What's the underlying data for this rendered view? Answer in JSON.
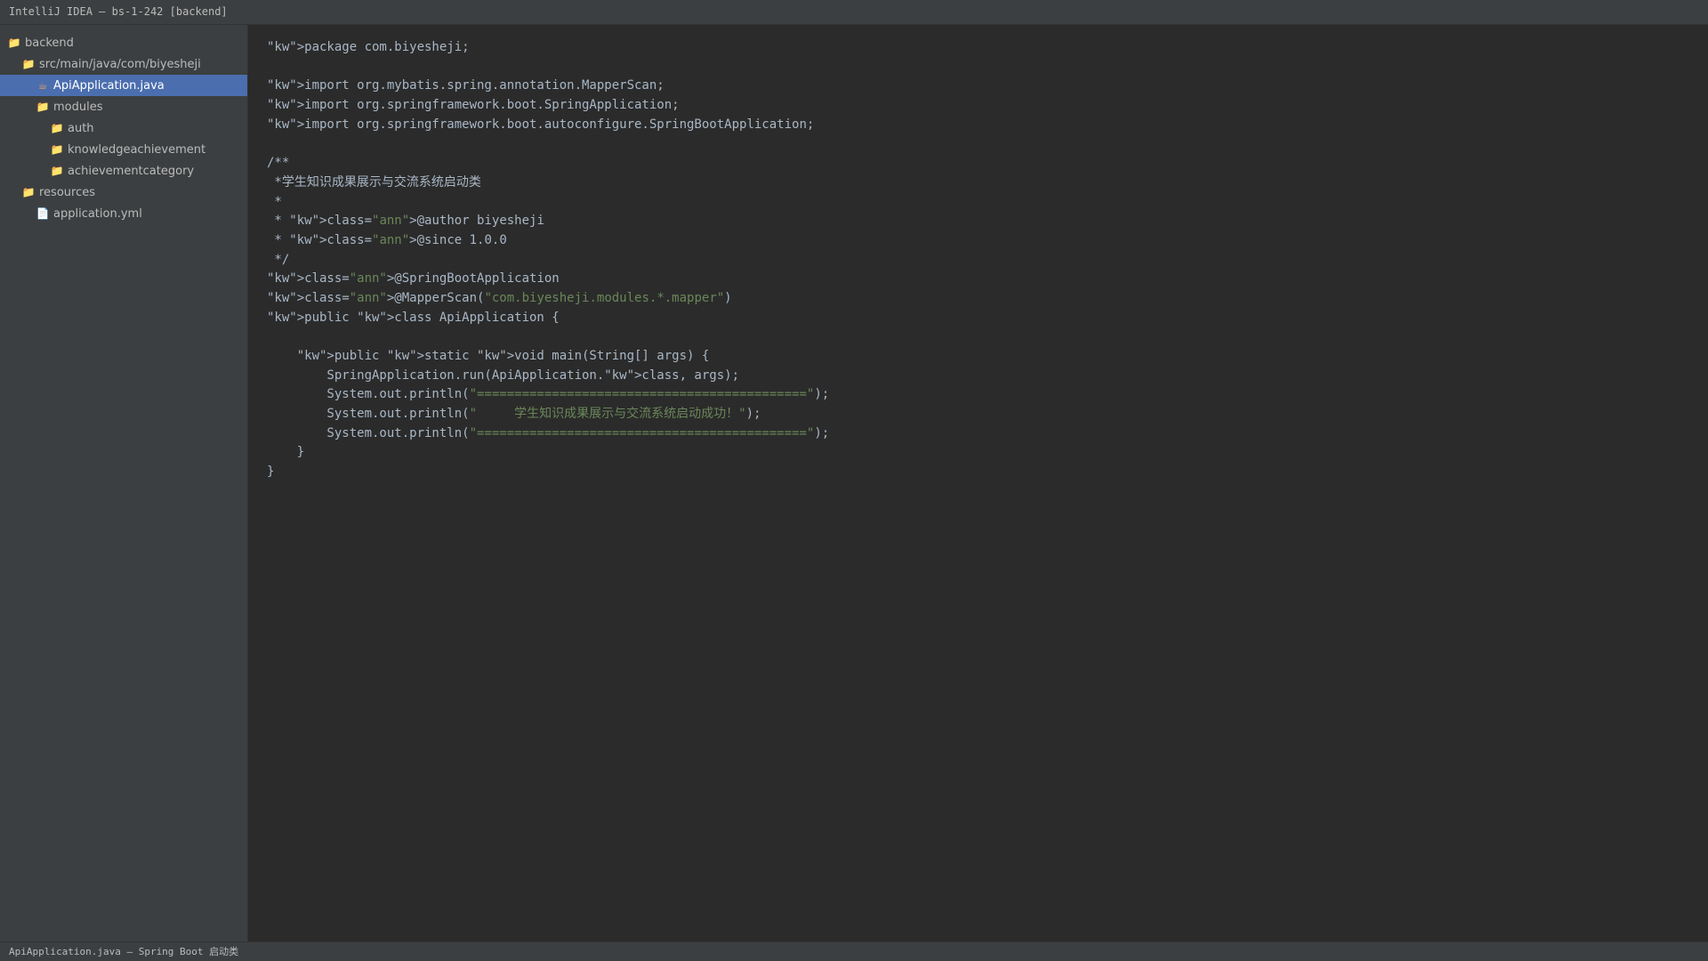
{
  "window": {
    "title": "IntelliJ IDEA — bs-1-242 [backend]"
  },
  "project_tree": {
    "items": [
      {
        "label": "backend",
        "icon": "folder-icon",
        "depth": 0,
        "selected": false
      },
      {
        "label": "src/main/java/com/biyesheji",
        "icon": "folder-icon",
        "depth": 1,
        "selected": false
      },
      {
        "label": "ApiApplication.java",
        "icon": "java-file-icon",
        "depth": 2,
        "selected": true
      },
      {
        "label": "modules",
        "icon": "folder-icon",
        "depth": 2,
        "selected": false
      },
      {
        "label": "auth",
        "icon": "folder-icon",
        "depth": 3,
        "selected": false
      },
      {
        "label": "knowledgeachievement",
        "icon": "folder-icon",
        "depth": 3,
        "selected": false
      },
      {
        "label": "achievementcategory",
        "icon": "folder-icon",
        "depth": 3,
        "selected": false
      },
      {
        "label": "resources",
        "icon": "folder-icon",
        "depth": 1,
        "selected": false
      },
      {
        "label": "application.yml",
        "icon": "file-icon",
        "depth": 2,
        "selected": false
      }
    ]
  },
  "editor": {
    "lines": [
      [
        {
          "t": "\"kw\">package com.biyesheji;"
        }
      ],
      [],
      [
        {
          "t": "\"kw\">import org.mybatis.spring.annotation.MapperScan;"
        }
      ],
      [
        {
          "t": "\"kw\">import org.springframework.boot.SpringApplication;"
        }
      ],
      [
        {
          "t": "\"kw\">import org.springframework.boot.autoconfigure.SpringBootApplication;"
        }
      ],
      [],
      [
        {
          "t": "/**"
        }
      ],
      [
        {
          "t": " *学生知识成果展示与交流系统启动类"
        }
      ],
      [
        {
          "t": " *"
        }
      ],
      [
        {
          "t": " * \"kw\">class="
        },
        {
          "t": "\"ann\"",
          "c": "str"
        },
        {
          "t": ">@author biyesheji"
        }
      ],
      [
        {
          "t": " * \"kw\">class="
        },
        {
          "t": "\"ann\"",
          "c": "str"
        },
        {
          "t": ">@since 1.0.0"
        }
      ],
      [
        {
          "t": " */"
        }
      ],
      [
        {
          "t": "\"kw\">class="
        },
        {
          "t": "\"ann\"",
          "c": "str"
        },
        {
          "t": ">@SpringBootApplication"
        }
      ],
      [
        {
          "t": "\"kw\">class="
        },
        {
          "t": "\"ann\"",
          "c": "str"
        },
        {
          "t": ">@MapperScan("
        },
        {
          "t": "\"com.biyesheji.modules.*.mapper\"",
          "c": "str"
        },
        {
          "t": ")"
        }
      ],
      [
        {
          "t": "\"kw\">public \"kw\">class ApiApplication {"
        }
      ],
      [],
      [
        {
          "t": "    \"kw\">public \"kw\">static \"kw\">void main(String[] args) {"
        }
      ],
      [
        {
          "t": "        SpringApplication.run(ApiApplication.\"kw\">class, args);"
        }
      ],
      [
        {
          "t": "        System.out.println("
        },
        {
          "t": "\"============================================\"",
          "c": "str"
        },
        {
          "t": ");"
        }
      ],
      [
        {
          "t": "        System.out.println("
        },
        {
          "t": "\"     学生知识成果展示与交流系统启动成功！\"",
          "c": "str"
        },
        {
          "t": ");"
        }
      ],
      [
        {
          "t": "        System.out.println("
        },
        {
          "t": "\"============================================\"",
          "c": "str"
        },
        {
          "t": ");"
        }
      ],
      [
        {
          "t": "    }"
        }
      ],
      [
        {
          "t": "}"
        }
      ]
    ]
  },
  "statusbar": {
    "text": "ApiApplication.java — Spring Boot 启动类"
  },
  "colors": {
    "string": "#6a8759",
    "text": "#a9b7c6",
    "selection": "#4b6eaf"
  }
}
